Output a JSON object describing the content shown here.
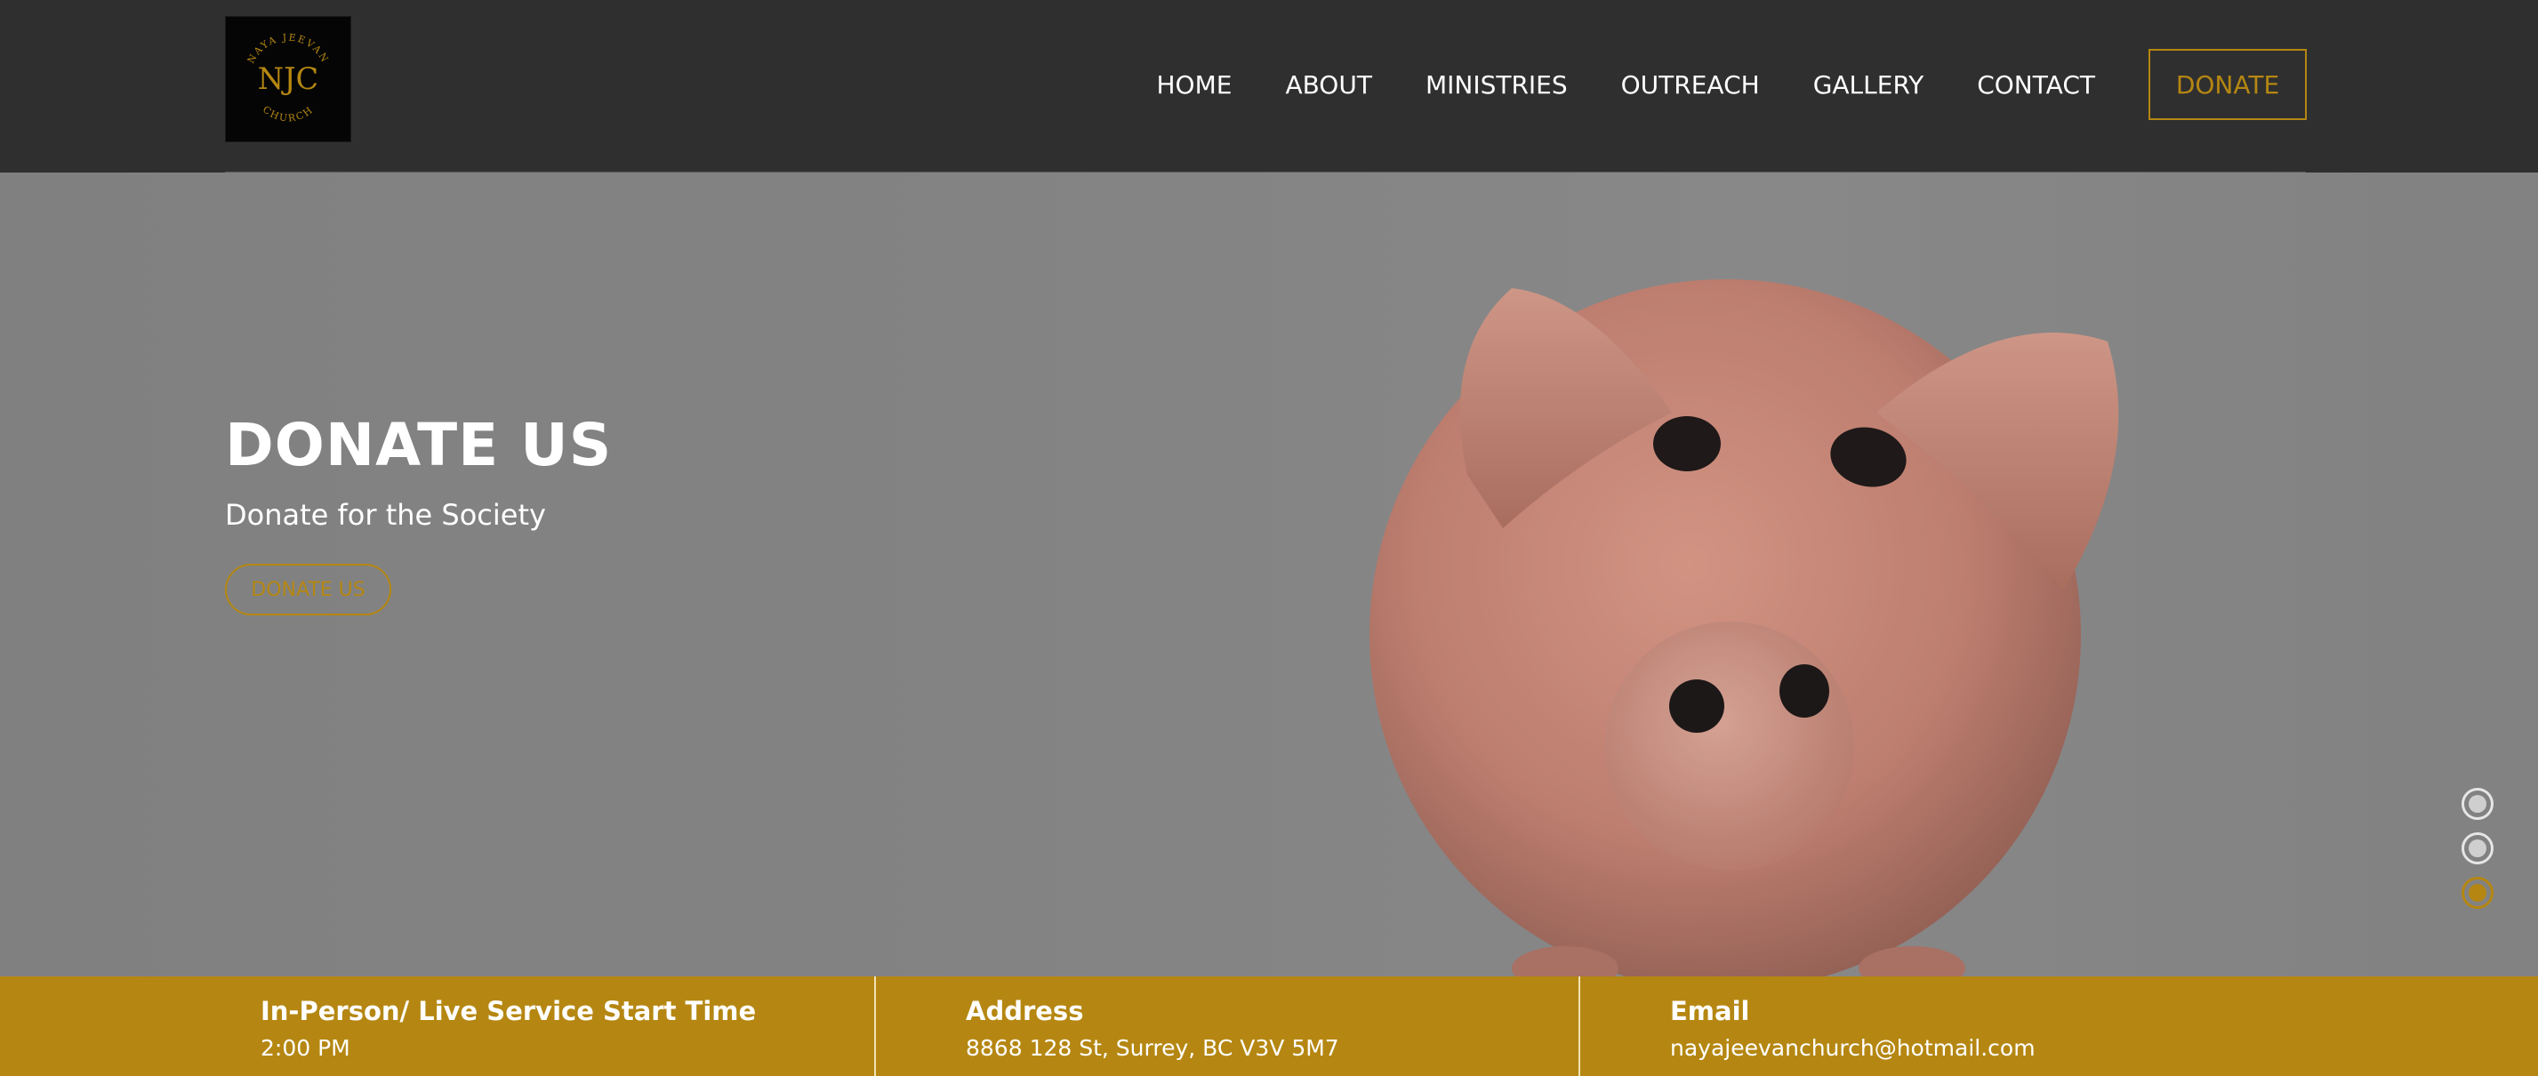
{
  "logo": {
    "top_text": "NAYA JEEVAN",
    "monogram": "NJC",
    "bottom_text": "CHURCH"
  },
  "nav": {
    "items": [
      "HOME",
      "ABOUT",
      "MINISTRIES",
      "OUTREACH",
      "GALLERY",
      "CONTACT"
    ],
    "donate_label": "DONATE"
  },
  "hero": {
    "title": "DONATE US",
    "subtitle": "Donate for the Society",
    "button_label": "DONATE US",
    "slide_count": 3,
    "active_slide": 3
  },
  "info": {
    "service": {
      "label": "In-Person/ Live Service Start Time",
      "value": "2:00 PM"
    },
    "address": {
      "label": "Address",
      "value": "8868 128 St, Surrey, BC V3V 5M7"
    },
    "email": {
      "label": "Email",
      "value": "nayajeevanchurch@hotmail.com"
    }
  },
  "colors": {
    "accent": "#b58712",
    "header_bg": "#2f2f2f",
    "infobar_bg": "#b58712"
  }
}
